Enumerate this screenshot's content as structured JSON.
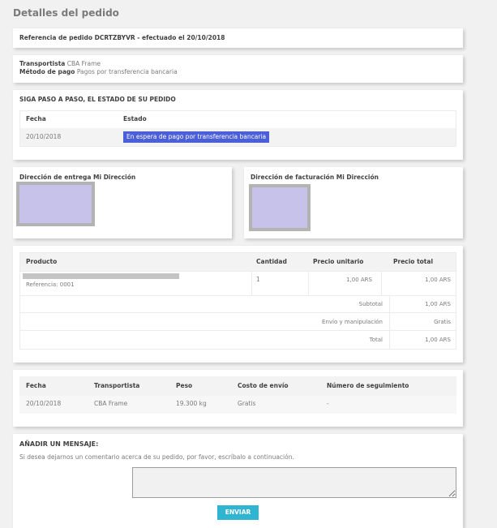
{
  "page_title": "Detalles del pedido",
  "reference": {
    "label": "Referencia de pedido DCRTZBYVR - efectuado el 20/10/2018"
  },
  "shipping": {
    "carrier_label": "Transportista",
    "carrier_value": "CBA Frame",
    "payment_label": "Método de pago",
    "payment_value": "Pagos por transferencia bancaria"
  },
  "status": {
    "heading": "SIGA PASO A PASO, EL ESTADO DE SU PEDIDO",
    "col_date": "Fecha",
    "col_state": "Estado",
    "rows": [
      {
        "date": "20/10/2018",
        "state": "En espera de pago por transferencia bancaria",
        "badge_color": "#4a5fd8"
      }
    ]
  },
  "addresses": {
    "delivery_heading": "Dirección de entrega Mi Dirección",
    "billing_heading": "Dirección de facturación Mi Dirección"
  },
  "products": {
    "headers": [
      "Producto",
      "Cantidad",
      "Precio unitario",
      "Precio total"
    ],
    "items": [
      {
        "reference": "Referencia: 0001",
        "quantity": "1",
        "unit_price": "1,00 ARS",
        "total_price": "1,00 ARS"
      }
    ],
    "subtotal_label": "Subtotal",
    "subtotal_value": "1,00 ARS",
    "shipping_label": "Envío y manipulación",
    "shipping_value": "Gratis",
    "total_label": "Total",
    "total_value": "1,00 ARS"
  },
  "shipments": {
    "headers": [
      "Fecha",
      "Transportista",
      "Peso",
      "Costo de envío",
      "Número de seguimiento"
    ],
    "rows": [
      {
        "date": "20/10/2018",
        "carrier": "CBA Frame",
        "weight": "19.300 kg",
        "cost": "Gratis",
        "tracking": "-"
      }
    ]
  },
  "message": {
    "heading": "AÑADIR UN MENSAJE:",
    "description": "Si desea dejarnos un comentario acerca de su pedido, por favor, escríbalo a continuación.",
    "textarea_value": "",
    "send_label": "ENVIAR"
  },
  "colors": {
    "accent": "#2fb5d2",
    "badge": "#4a5fd8",
    "background": "#f1f1f1"
  }
}
